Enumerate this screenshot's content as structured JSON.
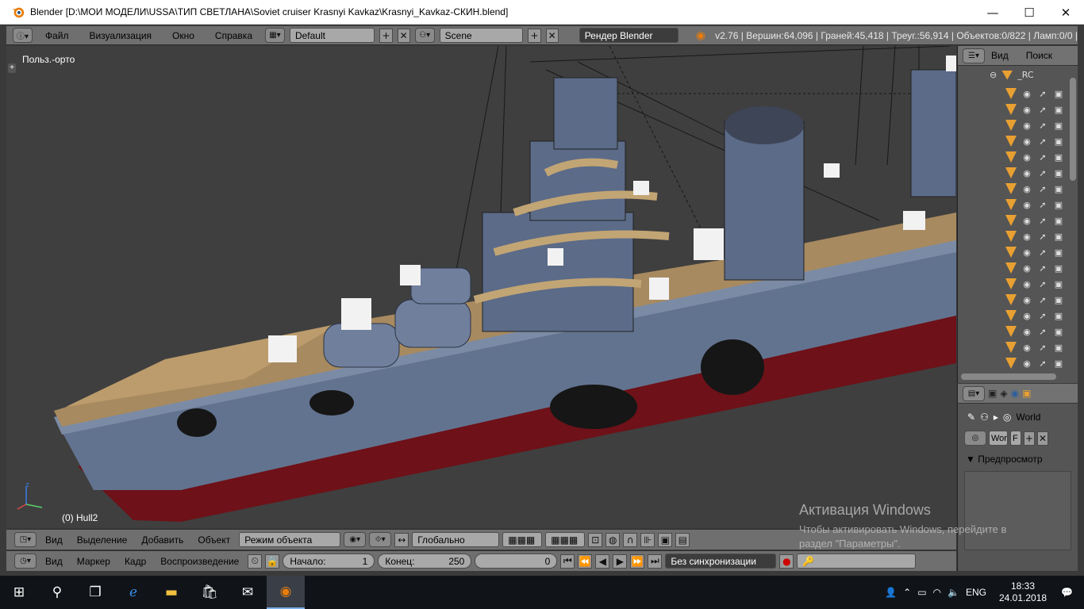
{
  "window": {
    "title": "Blender [D:\\МОИ МОДЕЛИ\\USSA\\ТИП СВЕТЛАНА\\Soviet cruiser Krasnyi Kavkaz\\Krasnyi_Kavkaz-СКИН.blend]",
    "minimize": "—",
    "maximize": "☐",
    "close": "✕"
  },
  "infobar": {
    "menu": [
      "Файл",
      "Визуализация",
      "Окно",
      "Справка"
    ],
    "screen_layout": "Default",
    "scene": "Scene",
    "render_engine": "Рендер Blender",
    "stats": "v2.76 | Вершин:64,096 | Граней:45,418 | Треуг.:56,914 | Объектов:0/822 | Ламп:0/0 | "
  },
  "viewport": {
    "view_label": "Польз.-орто",
    "object_label": "(0) Hull2"
  },
  "outliner": {
    "view": "Вид",
    "search": "Поиск",
    "root_label": "_RC"
  },
  "properties": {
    "world": "World",
    "world_field": "Wor",
    "world_f": "F",
    "preview": "Предпросмотр"
  },
  "header3d": {
    "view": "Вид",
    "select": "Выделение",
    "add": "Добавить",
    "object": "Объект",
    "mode": "Режим объекта",
    "orientation": "Глобально"
  },
  "timeline": {
    "view": "Вид",
    "marker": "Маркер",
    "frame": "Кадр",
    "playback": "Воспроизведение",
    "start_label": "Начало:",
    "start_value": "1",
    "end_label": "Конец:",
    "end_value": "250",
    "current_frame": "0",
    "sync": "Без синхронизации"
  },
  "watermark": {
    "title": "Активация Windows",
    "line1": "Чтобы активировать Windows, перейдите в",
    "line2": "раздел \"Параметры\"."
  },
  "taskbar": {
    "lang": "ENG",
    "time": "18:33",
    "date": "24.01.2018"
  }
}
